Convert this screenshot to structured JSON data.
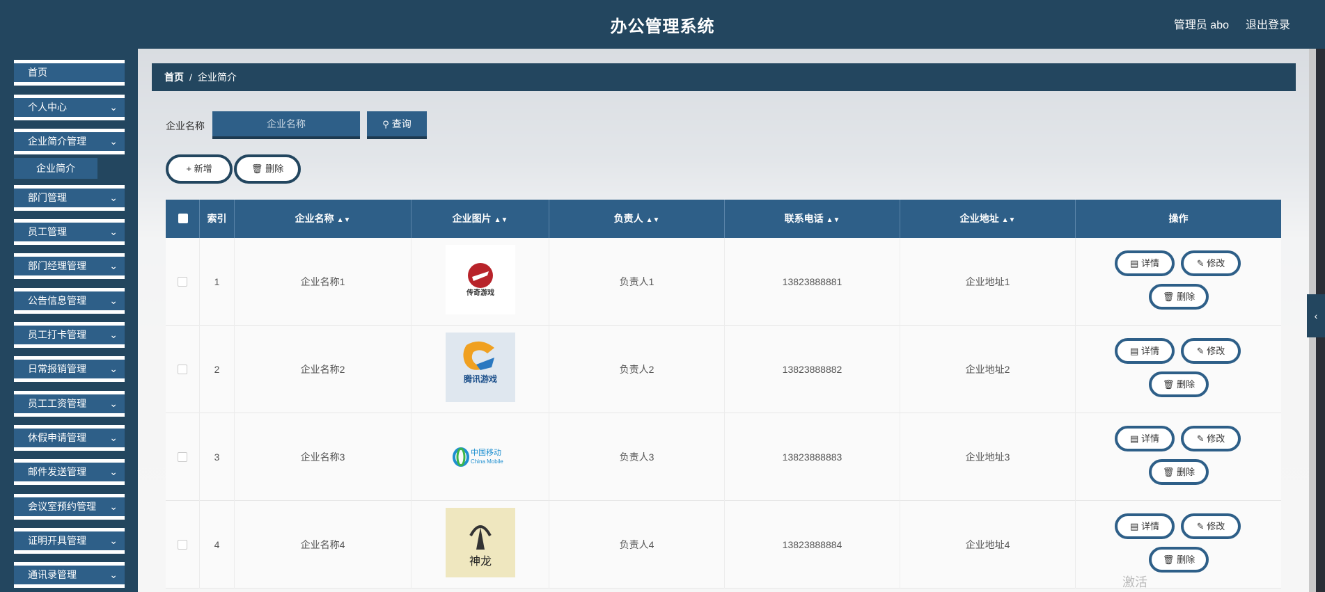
{
  "header": {
    "title": "办公管理系统",
    "user": "管理员 abo",
    "logout": "退出登录"
  },
  "sidebar": {
    "items": [
      {
        "label": "首页",
        "chevron": false
      },
      {
        "label": "个人中心",
        "chevron": true
      },
      {
        "label": "企业简介管理",
        "chevron": true
      },
      {
        "label": "部门管理",
        "chevron": true
      },
      {
        "label": "员工管理",
        "chevron": true
      },
      {
        "label": "部门经理管理",
        "chevron": true
      },
      {
        "label": "公告信息管理",
        "chevron": true
      },
      {
        "label": "员工打卡管理",
        "chevron": true
      },
      {
        "label": "日常报销管理",
        "chevron": true
      },
      {
        "label": "员工工资管理",
        "chevron": true
      },
      {
        "label": "休假申请管理",
        "chevron": true
      },
      {
        "label": "邮件发送管理",
        "chevron": true
      },
      {
        "label": "会议室预约管理",
        "chevron": true
      },
      {
        "label": "证明开具管理",
        "chevron": true
      },
      {
        "label": "通讯录管理",
        "chevron": true
      }
    ],
    "sub_item": "企业简介",
    "chevron_icon": "chevron-down-icon"
  },
  "breadcrumb": {
    "home": "首页",
    "sep": "/",
    "current": "企业简介"
  },
  "search": {
    "label": "企业名称",
    "placeholder": "企业名称",
    "button": "查询"
  },
  "actions": {
    "add": "新增",
    "delete": "删除"
  },
  "table": {
    "headers": {
      "index": "索引",
      "name": "企业名称",
      "image": "企业图片",
      "person": "负责人",
      "phone": "联系电话",
      "address": "企业地址",
      "ops": "操作"
    },
    "rows": [
      {
        "index": "1",
        "name": "企业名称1",
        "person": "负责人1",
        "phone": "13823888881",
        "address": "企业地址1",
        "logo": "red-emblem",
        "logo_text": "传奇游戏"
      },
      {
        "index": "2",
        "name": "企业名称2",
        "person": "负责人2",
        "phone": "13823888882",
        "address": "企业地址2",
        "logo": "tencent-games",
        "logo_text": "腾讯游戏"
      },
      {
        "index": "3",
        "name": "企业名称3",
        "person": "负责人3",
        "phone": "13823888883",
        "address": "企业地址3",
        "logo": "china-mobile",
        "logo_text": "中国移动",
        "logo_subtext": "China Mobile"
      },
      {
        "index": "4",
        "name": "企业名称4",
        "person": "负责人4",
        "phone": "13823888884",
        "address": "企业地址4",
        "logo": "tower-emblem"
      }
    ],
    "op_labels": {
      "detail": "详情",
      "edit": "修改",
      "delete": "删除"
    }
  },
  "watermark": "激活",
  "colors": {
    "dark": "#23465f",
    "accent": "#2e5f88"
  }
}
